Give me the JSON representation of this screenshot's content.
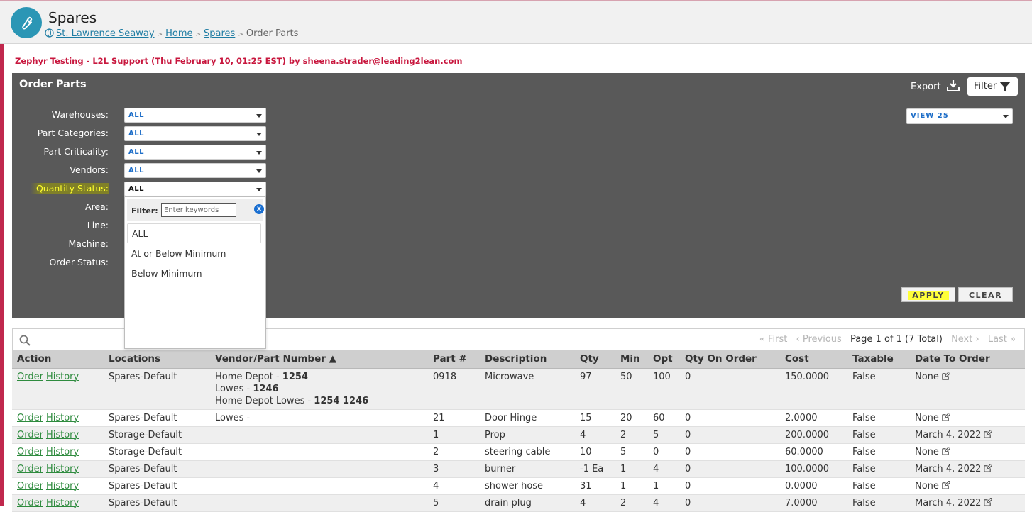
{
  "header": {
    "title": "Spares",
    "breadcrumb": [
      {
        "label": "St. Lawrence Seaway"
      },
      {
        "label": "Home"
      },
      {
        "label": "Spares"
      },
      {
        "label": "Order Parts"
      }
    ],
    "separator": ">"
  },
  "banner": "Zephyr Testing - L2L Support (Thu February 10, 01:25 EST) by sheena.strader@leading2lean.com",
  "panel": {
    "title": "Order Parts",
    "export_label": "Export",
    "filter_label": "Filter",
    "view_select": "VIEW 25",
    "apply_label": "APPLY",
    "clear_label": "CLEAR",
    "filters": [
      {
        "label": "Warehouses:",
        "value": "ALL"
      },
      {
        "label": "Part Categories:",
        "value": "ALL"
      },
      {
        "label": "Part Criticality:",
        "value": "ALL"
      },
      {
        "label": "Vendors:",
        "value": "ALL"
      },
      {
        "label": "Quantity Status:",
        "value": "ALL"
      },
      {
        "label": "Area:"
      },
      {
        "label": "Line:"
      },
      {
        "label": "Machine:"
      },
      {
        "label": "Order Status:"
      }
    ]
  },
  "dropdown": {
    "filter_label": "Filter:",
    "placeholder": "Enter keywords",
    "clear_glyph": "x",
    "options": [
      "ALL",
      "At or Below Minimum",
      "Below Minimum"
    ]
  },
  "pager": {
    "first": "« First",
    "previous": "‹ Previous",
    "status": "Page 1 of 1 (7 Total)",
    "next": "Next ›",
    "last": "Last »"
  },
  "table": {
    "columns": [
      "Action",
      "Locations",
      "Vendor/Part Number ▲",
      "Part #",
      "Description",
      "Qty",
      "Min",
      "Opt",
      "Qty On Order",
      "Cost",
      "Taxable",
      "Date To Order"
    ],
    "order_label": "Order",
    "history_label": "History",
    "rows": [
      {
        "location": "Spares-Default",
        "vendors": [
          {
            "name": "Home Depot - ",
            "num": "1254"
          },
          {
            "name": "Lowes - ",
            "num": "1246"
          },
          {
            "name": "Home Depot Lowes - ",
            "num": "1254 1246"
          }
        ],
        "part": "0918",
        "desc": "Microwave",
        "qty": "97",
        "min": "50",
        "opt": "100",
        "on_order": "0",
        "cost": "150.0000",
        "taxable": "False",
        "date": "None"
      },
      {
        "location": "Spares-Default",
        "vendors": [
          {
            "name": "Lowes - ",
            "num": ""
          }
        ],
        "part": "21",
        "desc": "Door Hinge",
        "qty": "15",
        "min": "20",
        "opt": "60",
        "on_order": "0",
        "cost": "2.0000",
        "taxable": "False",
        "date": "None"
      },
      {
        "location": "Storage-Default",
        "vendors": [],
        "part": "1",
        "desc": "Prop",
        "qty": "4",
        "min": "2",
        "opt": "5",
        "on_order": "0",
        "cost": "200.0000",
        "taxable": "False",
        "date": "March 4, 2022"
      },
      {
        "location": "Storage-Default",
        "vendors": [],
        "part": "2",
        "desc": "steering cable",
        "qty": "10",
        "min": "5",
        "opt": "0",
        "on_order": "0",
        "cost": "60.0000",
        "taxable": "False",
        "date": "None"
      },
      {
        "location": "Spares-Default",
        "vendors": [],
        "part": "3",
        "desc": "burner",
        "qty": "-1 Ea",
        "min": "1",
        "opt": "4",
        "on_order": "0",
        "cost": "100.0000",
        "taxable": "False",
        "date": "March 4, 2022"
      },
      {
        "location": "Spares-Default",
        "vendors": [],
        "part": "4",
        "desc": "shower hose",
        "qty": "31",
        "min": "1",
        "opt": "1",
        "on_order": "0",
        "cost": "0.0000",
        "taxable": "False",
        "date": "None"
      },
      {
        "location": "Spares-Default",
        "vendors": [],
        "part": "5",
        "desc": "drain plug",
        "qty": "4",
        "min": "2",
        "opt": "4",
        "on_order": "0",
        "cost": "7.0000",
        "taxable": "False",
        "date": "March 4, 2022"
      }
    ]
  },
  "colors": {
    "accent": "#2b96b5",
    "banner": "#c8173e",
    "panel": "#595959",
    "link": "#2e8b3e"
  }
}
